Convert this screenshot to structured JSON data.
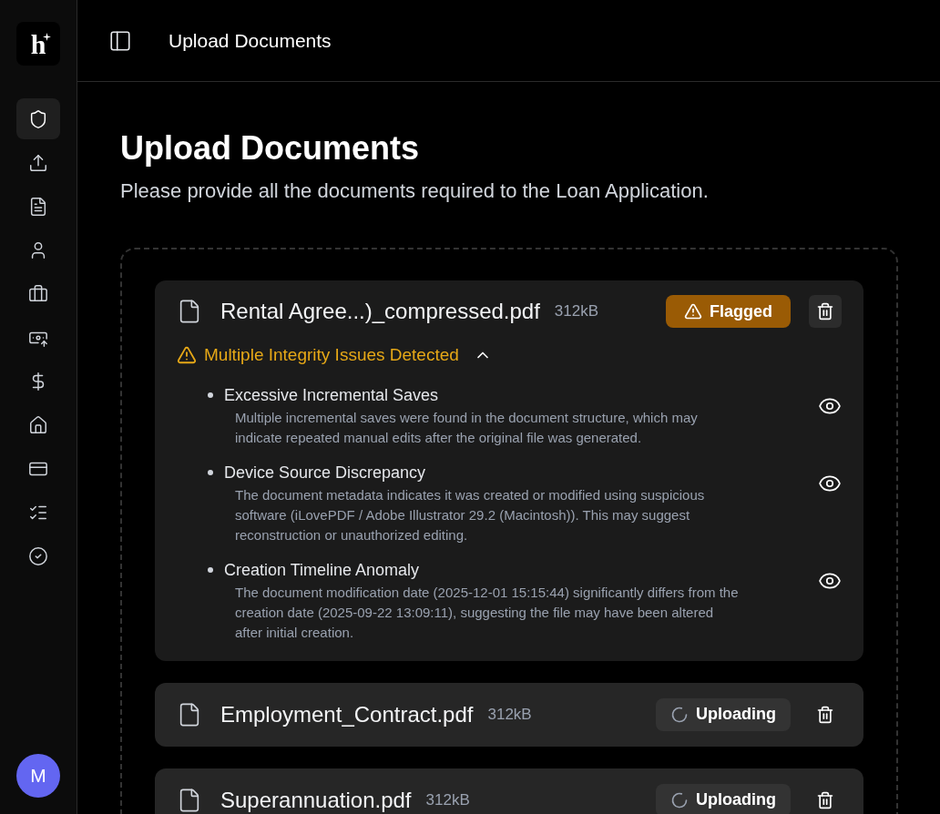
{
  "logo": {
    "letter": "h"
  },
  "sidebar": {
    "items": [
      {
        "selected": true
      },
      {
        "selected": false
      },
      {
        "selected": false
      },
      {
        "selected": false
      },
      {
        "selected": false
      },
      {
        "selected": false
      },
      {
        "selected": false
      },
      {
        "selected": false
      },
      {
        "selected": false
      },
      {
        "selected": false
      },
      {
        "selected": false
      }
    ],
    "avatar": "M"
  },
  "header": {
    "title": "Upload Documents"
  },
  "page": {
    "title": "Upload Documents",
    "subtitle": "Please provide all the documents required to the Loan Application."
  },
  "files": [
    {
      "name": "Rental Agree...)_compressed.pdf",
      "size": "312kB",
      "status": {
        "kind": "flagged",
        "label": "Flagged"
      },
      "issues": {
        "title": "Multiple Integrity Issues Detected",
        "expanded": true,
        "items": [
          {
            "title": "Excessive Incremental Saves",
            "description": "Multiple incremental saves were found in the document structure, which may indicate repeated manual edits after the original file was generated."
          },
          {
            "title": "Device Source Discrepancy",
            "description": "The document metadata indicates it was created or modified using suspicious software (iLovePDF / Adobe Illustrator 29.2 (Macintosh)). This may suggest reconstruction or unauthorized editing."
          },
          {
            "title": "Creation Timeline Anomaly",
            "description": "The document modification date (2025-12-01 15:15:44) significantly differs from the creation date (2025-09-22 13:09:11), suggesting the file may have been altered after initial creation."
          }
        ]
      }
    },
    {
      "name": "Employment_Contract.pdf",
      "size": "312kB",
      "status": {
        "kind": "uploading",
        "label": "Uploading"
      }
    },
    {
      "name": "Superannuation.pdf",
      "size": "312kB",
      "status": {
        "kind": "uploading",
        "label": "Uploading"
      }
    }
  ]
}
